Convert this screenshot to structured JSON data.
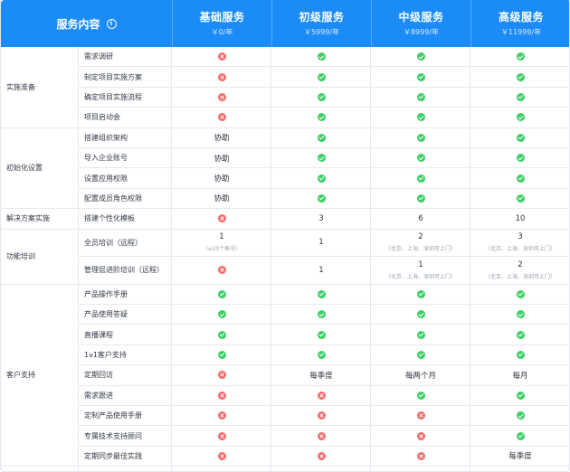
{
  "header": {
    "first": "服务内容",
    "info_icon": "i",
    "plans": [
      {
        "name": "基础服务",
        "price": "￥0/年"
      },
      {
        "name": "初级服务",
        "price": "￥5999/年"
      },
      {
        "name": "中级服务",
        "price": "￥8999/年"
      },
      {
        "name": "高级服务",
        "price": "￥11999/年"
      }
    ]
  },
  "categories": [
    {
      "name": "实施准备",
      "rows": [
        {
          "label": "需求调研",
          "cells": [
            {
              "icon": "no"
            },
            {
              "icon": "yes"
            },
            {
              "icon": "yes"
            },
            {
              "icon": "yes"
            }
          ]
        },
        {
          "label": "制定项目实施方案",
          "cells": [
            {
              "icon": "no"
            },
            {
              "icon": "yes"
            },
            {
              "icon": "yes"
            },
            {
              "icon": "yes"
            }
          ]
        },
        {
          "label": "确定项目实施流程",
          "cells": [
            {
              "icon": "no"
            },
            {
              "icon": "yes"
            },
            {
              "icon": "yes"
            },
            {
              "icon": "yes"
            }
          ]
        },
        {
          "label": "项目启动会",
          "cells": [
            {
              "icon": "no"
            },
            {
              "icon": "yes"
            },
            {
              "icon": "yes"
            },
            {
              "icon": "yes"
            }
          ]
        }
      ]
    },
    {
      "name": "初始化设置",
      "rows": [
        {
          "label": "搭建组织架构",
          "cells": [
            {
              "text": "协助"
            },
            {
              "icon": "yes"
            },
            {
              "icon": "yes"
            },
            {
              "icon": "yes"
            }
          ]
        },
        {
          "label": "导入企业账号",
          "cells": [
            {
              "text": "协助"
            },
            {
              "icon": "yes"
            },
            {
              "icon": "yes"
            },
            {
              "icon": "yes"
            }
          ]
        },
        {
          "label": "设置应用权限",
          "cells": [
            {
              "text": "协助"
            },
            {
              "icon": "yes"
            },
            {
              "icon": "yes"
            },
            {
              "icon": "yes"
            }
          ]
        },
        {
          "label": "配置成员角色权限",
          "cells": [
            {
              "text": "协助"
            },
            {
              "icon": "yes"
            },
            {
              "icon": "yes"
            },
            {
              "icon": "yes"
            }
          ]
        }
      ]
    },
    {
      "name": "解决方案实施",
      "rows": [
        {
          "label": "搭建个性化模板",
          "cells": [
            {
              "icon": "no"
            },
            {
              "text": "3"
            },
            {
              "text": "6"
            },
            {
              "text": "10"
            }
          ]
        }
      ]
    },
    {
      "name": "功能培训",
      "rows": [
        {
          "label": "全员培训（远程）",
          "tall": true,
          "cells": [
            {
              "text": "1",
              "sub": "（≤20个账号）"
            },
            {
              "text": "1"
            },
            {
              "text": "2",
              "sub": "（北京、上海、深圳可上门）"
            },
            {
              "text": "3",
              "sub": "（北京、上海、深圳可上门）"
            }
          ]
        },
        {
          "label": "管理层进阶培训（远程）",
          "tall": true,
          "cells": [
            {
              "icon": "no"
            },
            {
              "text": "1"
            },
            {
              "text": "1",
              "sub": "（北京、上海、深圳可上门）"
            },
            {
              "text": "2",
              "sub": "（北京、上海、深圳可上门）"
            }
          ]
        }
      ]
    },
    {
      "name": "客户支持",
      "rows": [
        {
          "label": "产品操作手册",
          "cells": [
            {
              "icon": "yes"
            },
            {
              "icon": "yes"
            },
            {
              "icon": "yes"
            },
            {
              "icon": "yes"
            }
          ]
        },
        {
          "label": "产品使用答疑",
          "cells": [
            {
              "icon": "yes"
            },
            {
              "icon": "yes"
            },
            {
              "icon": "yes"
            },
            {
              "icon": "yes"
            }
          ]
        },
        {
          "label": "直播课程",
          "cells": [
            {
              "icon": "yes"
            },
            {
              "icon": "yes"
            },
            {
              "icon": "yes"
            },
            {
              "icon": "yes"
            }
          ]
        },
        {
          "label": "1v1客户支持",
          "cells": [
            {
              "icon": "yes"
            },
            {
              "icon": "yes"
            },
            {
              "icon": "yes"
            },
            {
              "icon": "yes"
            }
          ]
        },
        {
          "label": "定期回访",
          "cells": [
            {
              "icon": "no"
            },
            {
              "text": "每季度"
            },
            {
              "text": "每两个月"
            },
            {
              "text": "每月"
            }
          ]
        },
        {
          "label": "需求跟进",
          "cells": [
            {
              "icon": "no"
            },
            {
              "icon": "no"
            },
            {
              "icon": "yes"
            },
            {
              "icon": "yes"
            }
          ]
        },
        {
          "label": "定制产品使用手册",
          "cells": [
            {
              "icon": "no"
            },
            {
              "icon": "no"
            },
            {
              "icon": "no"
            },
            {
              "icon": "yes"
            }
          ]
        },
        {
          "label": "专属技术支持顾问",
          "cells": [
            {
              "icon": "no"
            },
            {
              "icon": "no"
            },
            {
              "icon": "no"
            },
            {
              "icon": "yes"
            }
          ]
        },
        {
          "label": "定期同步最佳实践",
          "cells": [
            {
              "icon": "no"
            },
            {
              "icon": "no"
            },
            {
              "icon": "no"
            },
            {
              "text": "每季度"
            }
          ]
        }
      ]
    }
  ]
}
